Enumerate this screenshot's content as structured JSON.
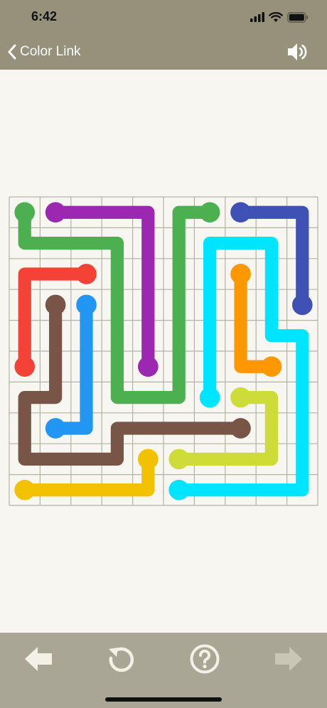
{
  "status_bar": {
    "time": "6:42",
    "icons": [
      "signal-icon",
      "wifi-icon",
      "battery-icon"
    ]
  },
  "nav": {
    "back_label": "Color Link",
    "back_icon": "chevron-left-icon",
    "sound_icon": "speaker-icon"
  },
  "colors": {
    "bar": "#95917b",
    "toolbar": "#aaa695",
    "background": "#f7f6f1",
    "grid": "#b4b2a6"
  },
  "board": {
    "rows": 10,
    "cols": 10,
    "flows": [
      {
        "color": "green",
        "hex": "#4caf50",
        "path": [
          [
            0,
            0
          ],
          [
            1,
            0
          ],
          [
            1,
            1
          ],
          [
            1,
            2
          ],
          [
            1,
            3
          ],
          [
            2,
            3
          ],
          [
            3,
            3
          ],
          [
            4,
            3
          ],
          [
            5,
            3
          ],
          [
            6,
            3
          ],
          [
            6,
            4
          ],
          [
            6,
            5
          ],
          [
            5,
            5
          ],
          [
            4,
            5
          ],
          [
            3,
            5
          ],
          [
            2,
            5
          ],
          [
            1,
            5
          ],
          [
            0,
            5
          ],
          [
            0,
            6
          ]
        ]
      },
      {
        "color": "purple",
        "hex": "#9c27b0",
        "path": [
          [
            0,
            1
          ],
          [
            0,
            2
          ],
          [
            0,
            3
          ],
          [
            0,
            4
          ],
          [
            1,
            4
          ],
          [
            2,
            4
          ],
          [
            3,
            4
          ],
          [
            4,
            4
          ],
          [
            5,
            4
          ]
        ]
      },
      {
        "color": "dark-blue",
        "hex": "#3f51b5",
        "path": [
          [
            0,
            7
          ],
          [
            0,
            8
          ],
          [
            0,
            9
          ],
          [
            1,
            9
          ],
          [
            2,
            9
          ],
          [
            3,
            9
          ]
        ]
      },
      {
        "color": "red",
        "hex": "#f44336",
        "path": [
          [
            2,
            2
          ],
          [
            2,
            1
          ],
          [
            2,
            0
          ],
          [
            3,
            0
          ],
          [
            4,
            0
          ],
          [
            5,
            0
          ]
        ]
      },
      {
        "color": "brown",
        "hex": "#795548",
        "path": [
          [
            3,
            1
          ],
          [
            4,
            1
          ],
          [
            5,
            1
          ],
          [
            6,
            1
          ],
          [
            6,
            0
          ],
          [
            7,
            0
          ],
          [
            8,
            0
          ],
          [
            8,
            1
          ],
          [
            8,
            2
          ],
          [
            8,
            3
          ],
          [
            7,
            3
          ],
          [
            7,
            4
          ],
          [
            7,
            5
          ],
          [
            7,
            6
          ],
          [
            7,
            7
          ]
        ]
      },
      {
        "color": "blue",
        "hex": "#2196f3",
        "path": [
          [
            3,
            2
          ],
          [
            4,
            2
          ],
          [
            5,
            2
          ],
          [
            6,
            2
          ],
          [
            7,
            2
          ],
          [
            7,
            1
          ]
        ]
      },
      {
        "color": "cyan",
        "hex": "#00e5ff",
        "path": [
          [
            6,
            6
          ],
          [
            5,
            6
          ],
          [
            4,
            6
          ],
          [
            3,
            6
          ],
          [
            2,
            6
          ],
          [
            1,
            6
          ],
          [
            1,
            7
          ],
          [
            1,
            8
          ],
          [
            2,
            8
          ],
          [
            3,
            8
          ],
          [
            4,
            8
          ],
          [
            4,
            9
          ],
          [
            5,
            9
          ],
          [
            6,
            9
          ],
          [
            7,
            9
          ],
          [
            8,
            9
          ],
          [
            9,
            9
          ],
          [
            9,
            8
          ],
          [
            9,
            7
          ],
          [
            9,
            6
          ],
          [
            9,
            5
          ]
        ]
      },
      {
        "color": "orange",
        "hex": "#ff9800",
        "path": [
          [
            2,
            7
          ],
          [
            3,
            7
          ],
          [
            4,
            7
          ],
          [
            5,
            7
          ],
          [
            5,
            8
          ]
        ]
      },
      {
        "color": "lime",
        "hex": "#cddc39",
        "path": [
          [
            6,
            7
          ],
          [
            6,
            8
          ],
          [
            7,
            8
          ],
          [
            8,
            8
          ],
          [
            8,
            7
          ],
          [
            8,
            6
          ],
          [
            8,
            5
          ]
        ]
      },
      {
        "color": "yellow",
        "hex": "#f2c200",
        "path": [
          [
            9,
            0
          ],
          [
            9,
            1
          ],
          [
            9,
            2
          ],
          [
            9,
            3
          ],
          [
            9,
            4
          ],
          [
            8,
            4
          ]
        ]
      }
    ]
  },
  "toolbar": {
    "buttons": [
      {
        "name": "back-level-button",
        "icon": "arrow-left-icon"
      },
      {
        "name": "restart-button",
        "icon": "restart-icon"
      },
      {
        "name": "help-button",
        "icon": "help-icon"
      },
      {
        "name": "next-level-button",
        "icon": "arrow-right-icon"
      }
    ]
  }
}
